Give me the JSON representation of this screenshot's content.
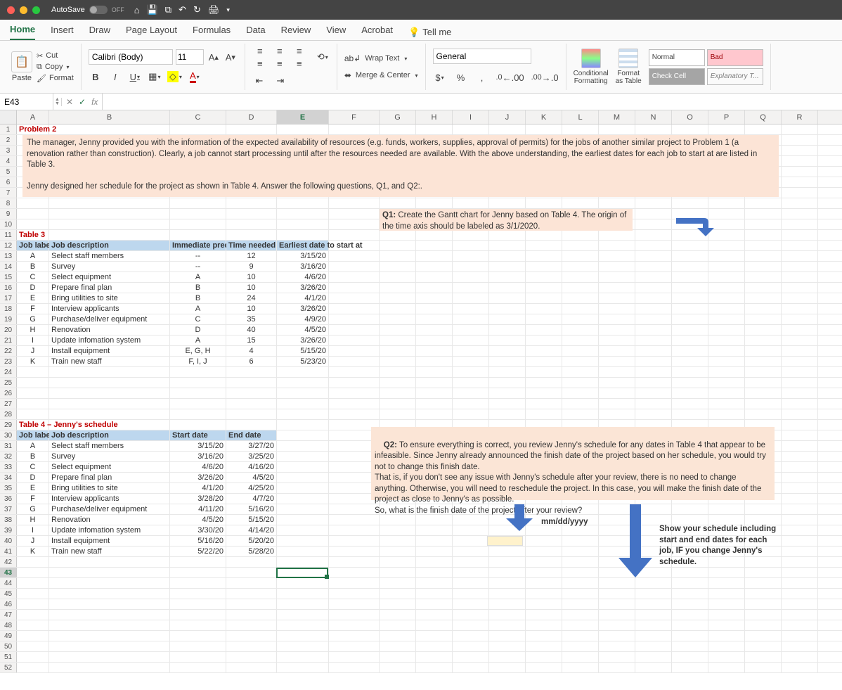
{
  "app": {
    "autosave_label": "AutoSave",
    "autosave_state": "OFF"
  },
  "tabs": [
    "Home",
    "Insert",
    "Draw",
    "Page Layout",
    "Formulas",
    "Data",
    "Review",
    "View",
    "Acrobat"
  ],
  "tellme": "Tell me",
  "ribbon": {
    "paste": "Paste",
    "cut": "Cut",
    "copy": "Copy",
    "format": "Format",
    "font_name": "Calibri (Body)",
    "font_size": "11",
    "wrap": "Wrap Text",
    "merge": "Merge & Center",
    "number_format": "General",
    "cond_fmt": "Conditional\nFormatting",
    "fmt_table": "Format\nas Table",
    "style_normal": "Normal",
    "style_bad": "Bad",
    "style_check": "Check Cell",
    "style_expl": "Explanatory T..."
  },
  "namebox": "E43",
  "formula": "",
  "columns": [
    "A",
    "B",
    "C",
    "D",
    "E",
    "F",
    "G",
    "H",
    "I",
    "J",
    "K",
    "L",
    "M",
    "N",
    "O",
    "P",
    "Q",
    "R"
  ],
  "problem_title": "Problem 2",
  "intro_text": "The manager, Jenny provided you with the information of the expected availability of resources (e.g. funds, workers, supplies, approval of permits) for the jobs of another similar project to Problem 1 (a renovation rather than construction). Clearly, a job cannot start processing until after the resources needed are available. With the above understanding, the earliest dates for each job to start at are listed in Table 3.\n\nJenny designed her schedule for the project as shown in Table 4. Answer the following questions, Q1, and Q2:.",
  "q1_label": "Q1:",
  "q1_text": " Create the Gantt chart for Jenny based on Table 4. The origin of the time axis should be labeled as 3/1/2020.",
  "q2_label": "Q2:",
  "q2_text": " To ensure everything is correct, you review Jenny's schedule for any dates in Table 4 that appear to be infeasible. Since Jenny already announced the finish date of the project based on her schedule, you would try not to change this finish date.\nThat is, if you don't see any issue with Jenny's schedule after your review, there is no need to change anything. Otherwise, you will need to reschedule the project. In this case, you will make the finish date of the project as close to Jenny's as possible.\nSo, what is the finish date of the project after your review?",
  "date_hint": "mm/dd/yyyy",
  "sched_hint": "Show your schedule including start and end dates for each job, IF you change Jenny's schedule.",
  "table3_title": "Table 3",
  "table3_headers": {
    "job_label": "Job label",
    "job_desc": "Job description",
    "pred": "Immediate predecessor(s)",
    "time": "Time needed (days)",
    "earliest": "Earliest date to start at"
  },
  "table3": [
    {
      "l": "A",
      "d": "Select staff members",
      "p": "--",
      "t": "12",
      "e": "3/15/20"
    },
    {
      "l": "B",
      "d": "Survey",
      "p": "--",
      "t": "9",
      "e": "3/16/20"
    },
    {
      "l": "C",
      "d": "Select equipment",
      "p": "A",
      "t": "10",
      "e": "4/6/20"
    },
    {
      "l": "D",
      "d": "Prepare final plan",
      "p": "B",
      "t": "10",
      "e": "3/26/20"
    },
    {
      "l": "E",
      "d": "Bring utilities to site",
      "p": "B",
      "t": "24",
      "e": "4/1/20"
    },
    {
      "l": "F",
      "d": "Interview applicants",
      "p": "A",
      "t": "10",
      "e": "3/26/20"
    },
    {
      "l": "G",
      "d": "Purchase/deliver equipment",
      "p": "C",
      "t": "35",
      "e": "4/9/20"
    },
    {
      "l": "H",
      "d": "Renovation",
      "p": "D",
      "t": "40",
      "e": "4/5/20"
    },
    {
      "l": "I",
      "d": "Update infomation system",
      "p": "A",
      "t": "15",
      "e": "3/26/20"
    },
    {
      "l": "J",
      "d": "Install equipment",
      "p": "E, G, H",
      "t": "4",
      "e": "5/15/20"
    },
    {
      "l": "K",
      "d": "Train new staff",
      "p": "F, I, J",
      "t": "6",
      "e": "5/23/20"
    }
  ],
  "table4_title": "Table 4 – Jenny's schedule",
  "table4_headers": {
    "job_label": "Job label",
    "job_desc": "Job description",
    "start": "Start date",
    "end": "End date"
  },
  "table4": [
    {
      "l": "A",
      "d": "Select staff members",
      "s": "3/15/20",
      "e": "3/27/20"
    },
    {
      "l": "B",
      "d": "Survey",
      "s": "3/16/20",
      "e": "3/25/20"
    },
    {
      "l": "C",
      "d": "Select equipment",
      "s": "4/6/20",
      "e": "4/16/20"
    },
    {
      "l": "D",
      "d": "Prepare final plan",
      "s": "3/26/20",
      "e": "4/5/20"
    },
    {
      "l": "E",
      "d": "Bring utilities to site",
      "s": "4/1/20",
      "e": "4/25/20"
    },
    {
      "l": "F",
      "d": "Interview applicants",
      "s": "3/28/20",
      "e": "4/7/20"
    },
    {
      "l": "G",
      "d": "Purchase/deliver equipment",
      "s": "4/11/20",
      "e": "5/16/20"
    },
    {
      "l": "H",
      "d": "Renovation",
      "s": "4/5/20",
      "e": "5/15/20"
    },
    {
      "l": "I",
      "d": "Update infomation system",
      "s": "3/30/20",
      "e": "4/14/20"
    },
    {
      "l": "J",
      "d": "Install equipment",
      "s": "5/16/20",
      "e": "5/20/20"
    },
    {
      "l": "K",
      "d": "Train new staff",
      "s": "5/22/20",
      "e": "5/28/20"
    }
  ]
}
